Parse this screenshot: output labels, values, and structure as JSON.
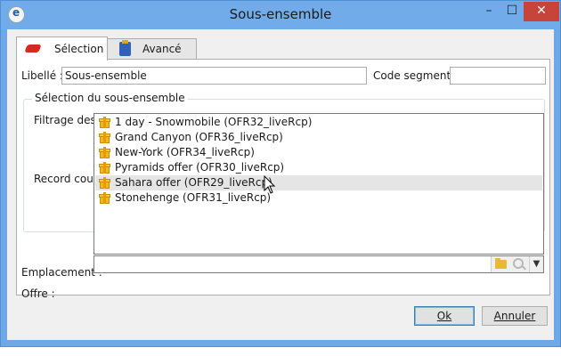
{
  "window": {
    "title": "Sous-ensemble"
  },
  "tabs": [
    {
      "label": "Sélection",
      "icon": "red-shape-icon"
    },
    {
      "label": "Avancé",
      "icon": "clipboard-icon"
    }
  ],
  "fields": {
    "libelle_label": "Libellé :",
    "libelle_value": "Sous-ensemble",
    "code_segment_label": "Code segment :",
    "code_segment_value": ""
  },
  "group": {
    "title": "Sélection du sous-ensemble",
    "filtrage_label": "Filtrage des e",
    "record_count_label": "Record coun"
  },
  "dropdown": {
    "items": [
      "1 day - Snowmobile (OFR32_liveRcp)",
      "Grand Canyon (OFR36_liveRcp)",
      "New-York (OFR34_liveRcp)",
      "Pyramids offer (OFR30_liveRcp)",
      "Sahara offer (OFR29_liveRcp)",
      "Stonehenge (OFR31_liveRcp)"
    ],
    "hovered": "Sahara offer (OFR29_liveRcp)"
  },
  "emplacement_label": "Emplacement :",
  "offre_label": "Offre :",
  "offre_value": "",
  "buttons": {
    "ok": "Ok",
    "annuler": "Annuler"
  }
}
